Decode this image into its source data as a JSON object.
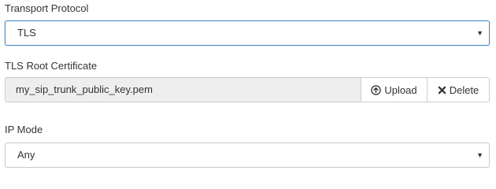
{
  "transport": {
    "label": "Transport Protocol",
    "selected": "TLS"
  },
  "tls_cert": {
    "label": "TLS Root Certificate",
    "filename": "my_sip_trunk_public_key.pem",
    "upload_label": "Upload",
    "delete_label": "Delete"
  },
  "ip_mode": {
    "label": "IP Mode",
    "selected": "Any"
  },
  "icons": {
    "upload": "arrow-up-circle-icon",
    "delete": "close-x-icon",
    "caret": "caret-down-icon"
  },
  "colors": {
    "focus_border": "#4a88c4",
    "readonly_bg": "#eeeeee"
  }
}
